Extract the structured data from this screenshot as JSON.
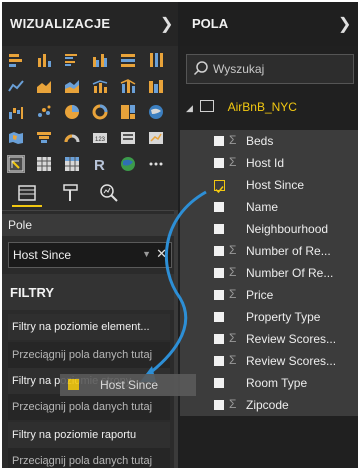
{
  "left": {
    "title": "WIZUALIZACJE",
    "field_section_label": "Pole",
    "field_value": "Host Since",
    "filters_title": "FILTRY",
    "filter_rows": [
      "Filtry na poziomie element...",
      "Przeciągnij pola danych tutaj",
      "Filtry na poziomie strony",
      "Przeciągnij pola danych tutaj",
      "Filtry na poziomie raportu",
      "Przeciągnij pola danych tutaj"
    ]
  },
  "right": {
    "title": "POLA",
    "search_placeholder": "Wyszukaj",
    "table_name": "AirBnB_NYC",
    "fields": [
      {
        "label": "Beds",
        "sigma": "Σ",
        "checked": false
      },
      {
        "label": "Host Id",
        "sigma": "Σ",
        "checked": false
      },
      {
        "label": "Host Since",
        "sigma": "",
        "checked": true
      },
      {
        "label": "Name",
        "sigma": "",
        "checked": false
      },
      {
        "label": "Neighbourhood",
        "sigma": "",
        "checked": false
      },
      {
        "label": "Number of Re...",
        "sigma": "Σ",
        "checked": false
      },
      {
        "label": "Number Of Re...",
        "sigma": "Σ",
        "checked": false
      },
      {
        "label": "Price",
        "sigma": "Σ",
        "checked": false
      },
      {
        "label": "Property Type",
        "sigma": "",
        "checked": false
      },
      {
        "label": "Review Scores...",
        "sigma": "Σ",
        "checked": false
      },
      {
        "label": "Review Scores...",
        "sigma": "Σ",
        "checked": false
      },
      {
        "label": "Room Type",
        "sigma": "",
        "checked": false
      },
      {
        "label": "Zipcode",
        "sigma": "Σ",
        "checked": false
      }
    ]
  },
  "drag_ghost": {
    "label": "Host Since"
  },
  "colors": {
    "accent": "#f2c811",
    "arrow": "#2d8fd6",
    "panel": "#2b2b2b"
  }
}
